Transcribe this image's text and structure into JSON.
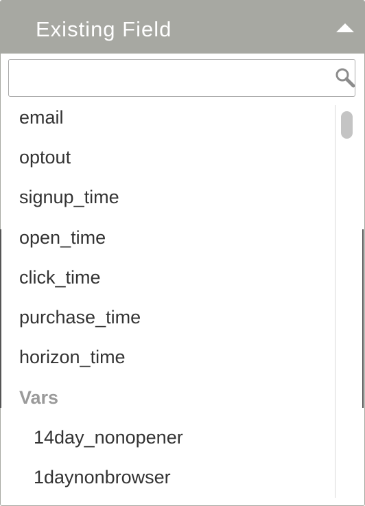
{
  "header": {
    "title": "Existing Field",
    "caret_icon": "caret-up-icon"
  },
  "search": {
    "value": "",
    "placeholder": "",
    "icon": "search-icon"
  },
  "list": {
    "fields": [
      "email",
      "optout",
      "signup_time",
      "open_time",
      "click_time",
      "purchase_time",
      "horizon_time"
    ],
    "group_label": "Vars",
    "vars": [
      "14day_nonopener",
      "1daynonbrowser"
    ]
  },
  "colors": {
    "header_bg": "#a7a8a2",
    "header_text": "#ffffff",
    "item_text": "#333333",
    "group_text": "#9a9a9a"
  }
}
